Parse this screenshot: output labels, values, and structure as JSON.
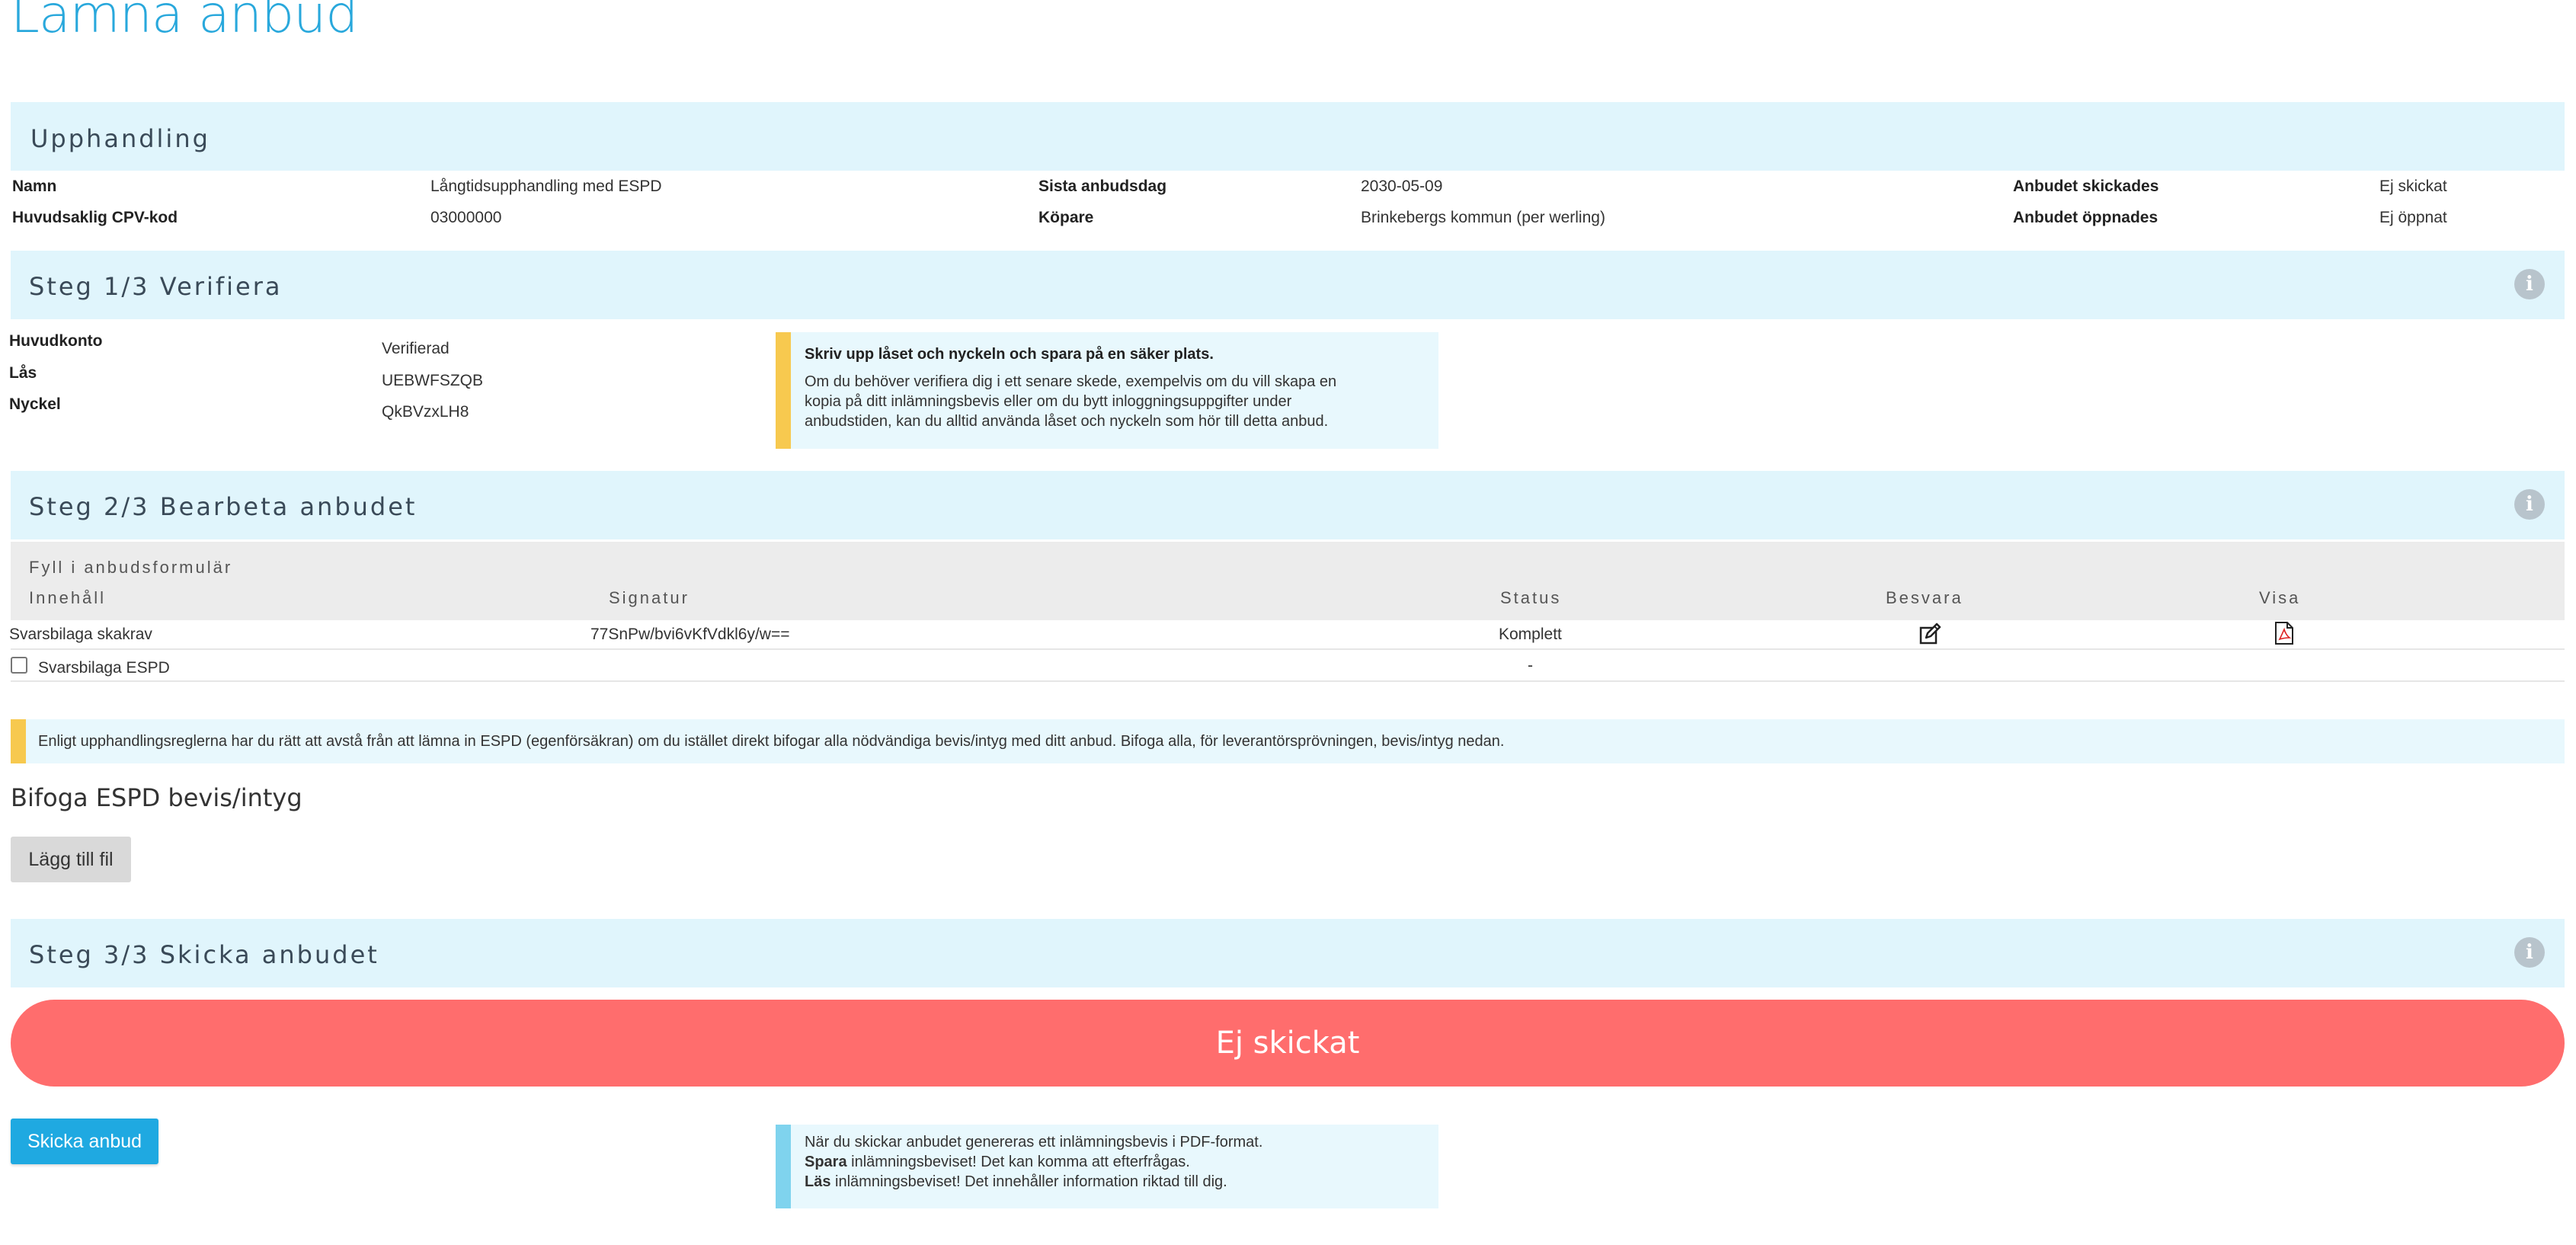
{
  "page": {
    "title": "Lämna anbud"
  },
  "procurement": {
    "header": "Upphandling",
    "name_label": "Namn",
    "name_value": "Långtidsupphandling med ESPD",
    "cpv_label": "Huvudsaklig CPV-kod",
    "cpv_value": "03000000",
    "deadline_label": "Sista anbudsdag",
    "deadline_value": "2030-05-09",
    "buyer_label": "Köpare",
    "buyer_value": "Brinkebergs kommun (per werling)",
    "sent_label": "Anbudet skickades",
    "sent_value": "Ej skickat",
    "opened_label": "Anbudet öppnades",
    "opened_value": "Ej öppnat"
  },
  "step1": {
    "header": "Steg 1/3 Verifiera",
    "account_label": "Huvudkonto",
    "account_value": "Verifierad",
    "lock_label": "Lås",
    "lock_value": "UEBWFSZQB",
    "key_label": "Nyckel",
    "key_value": "QkBVzxLH8",
    "note_title": "Skriv upp låset och nyckeln och spara på en säker plats.",
    "note_line1": "Om du behöver verifiera dig i ett senare skede, exempelvis om du vill skapa en",
    "note_line2": "kopia på ditt inlämningsbevis eller om du bytt inloggningsuppgifter under",
    "note_line3": "anbudstiden, kan du alltid använda låset och nyckeln som hör till detta anbud."
  },
  "step2": {
    "header": "Steg 2/3 Bearbeta anbudet",
    "table_caption": "Fyll i anbudsformulär",
    "columns": {
      "content": "Innehåll",
      "signature": "Signatur",
      "status": "Status",
      "answer": "Besvara",
      "view": "Visa"
    },
    "rows": [
      {
        "content": "Svarsbilaga skakrav",
        "signature": "77SnPw/bvi6vKfVdkl6y/w==",
        "status": "Komplett",
        "answer_icon": "edit-icon",
        "view_icon": "pdf-icon"
      },
      {
        "content": "Svarsbilaga ESPD",
        "signature": "",
        "status": "-",
        "checked": false
      }
    ],
    "espd_note": "Enligt upphandlingsreglerna har du rätt att avstå från att lämna in ESPD (egenförsäkran) om du istället direkt bifogar alla nödvändiga bevis/intyg med ditt anbud. Bifoga alla, för leverantörsprövningen, bevis/intyg nedan.",
    "attach_heading": "Bifoga ESPD bevis/intyg",
    "add_file_button": "Lägg till fil"
  },
  "step3": {
    "header": "Steg 3/3 Skicka anbudet",
    "status_text": "Ej skickat",
    "send_button": "Skicka anbud",
    "note_line1": "När du skickar anbudet genereras ett inlämningsbevis i PDF-format.",
    "note_line2_bold": "Spara",
    "note_line2_rest": " inlämningsbeviset! Det kan komma att efterfrågas.",
    "note_line3_bold": "Läs",
    "note_line3_rest": " inlämningsbeviset! Det innehåller information riktad till dig."
  },
  "colors": {
    "accent": "#29a8dc",
    "section_bg": "#e0f5fc",
    "status_not_sent": "#ff6d6d",
    "warning_bar": "#f7c94f",
    "info_bar": "#7fd3ee",
    "primary_button": "#1fa9e1"
  },
  "icons": {
    "info": "info-icon",
    "edit": "edit-icon",
    "pdf": "pdf-icon"
  }
}
